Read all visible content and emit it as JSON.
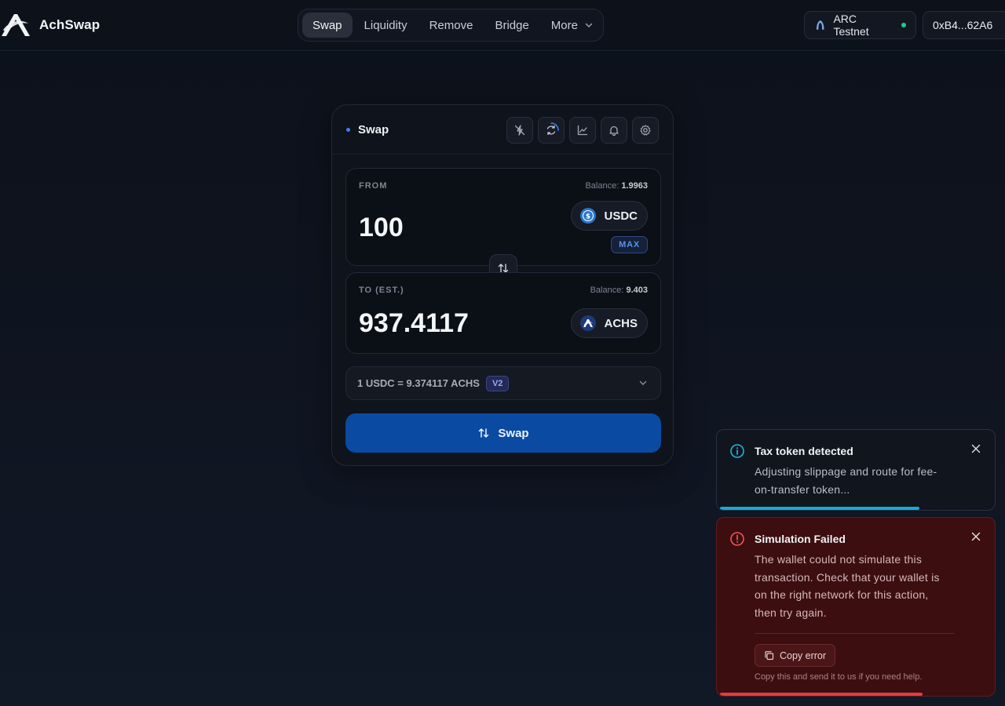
{
  "brand": {
    "name": "AchSwap"
  },
  "nav": {
    "items": [
      "Swap",
      "Liquidity",
      "Remove",
      "Bridge",
      "More"
    ],
    "active": "Swap"
  },
  "network": {
    "label": "ARC Testnet",
    "status_color": "#22c98e"
  },
  "wallet": {
    "address": "0xB4...62A6"
  },
  "swap_card": {
    "title": "Swap",
    "tools": [
      "no-mev-icon",
      "refresh-icon",
      "chart-icon",
      "bell-icon",
      "settings-icon"
    ],
    "from": {
      "label": "FROM",
      "balance_label": "Balance:",
      "balance": "1.9963",
      "amount": "100",
      "token": "USDC",
      "max_label": "MAX"
    },
    "to": {
      "label": "TO (EST.)",
      "balance_label": "Balance:",
      "balance": "9.403",
      "amount": "937.4117",
      "token": "ACHS"
    },
    "rate": {
      "text": "1 USDC = 9.374117 ACHS",
      "version": "V2"
    },
    "swap_button": "Swap",
    "accent_color": "#0a4aa3"
  },
  "toasts": {
    "info": {
      "title": "Tax token detected",
      "body": "Adjusting slippage and route for fee-on-transfer token...",
      "progress": 0.73
    },
    "error": {
      "title": "Simulation Failed",
      "body": "The wallet could not simulate this transaction. Check that your wallet is on the right network for this action, then try again.",
      "copy_button": "Copy error",
      "help": "Copy this and send it to us if you need help.",
      "progress": 0.74
    }
  }
}
